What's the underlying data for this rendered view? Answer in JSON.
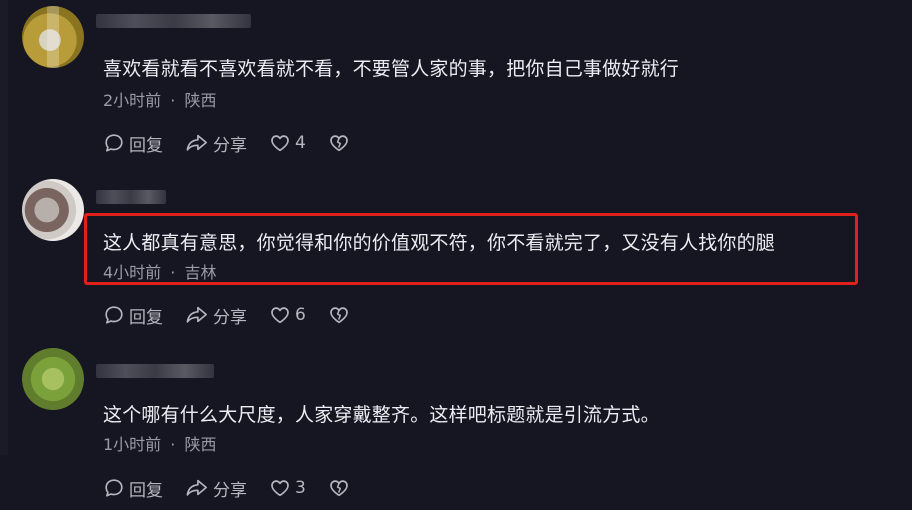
{
  "comments": [
    {
      "text": "喜欢看就看不喜欢看就不看，不要管人家的事，把你自己事做好就行",
      "time": "2小时前",
      "location": "陕西",
      "reply_label": "回复",
      "share_label": "分享",
      "likes": "4"
    },
    {
      "text": "这人都真有意思，你觉得和你的价值观不符，你不看就完了，又没有人找你的腿",
      "time": "4小时前",
      "location": "吉林",
      "reply_label": "回复",
      "share_label": "分享",
      "likes": "6"
    },
    {
      "text": "这个哪有什么大尺度，人家穿戴整齐。这样吧标题就是引流方式。",
      "time": "1小时前",
      "location": "陕西",
      "reply_label": "回复",
      "share_label": "分享",
      "likes": "3"
    }
  ],
  "meta_separator": "·",
  "colors": {
    "highlight": "#e0211b",
    "background": "#161622"
  },
  "icons": [
    "comment-icon",
    "share-icon",
    "heart-icon",
    "broken-heart-icon"
  ]
}
